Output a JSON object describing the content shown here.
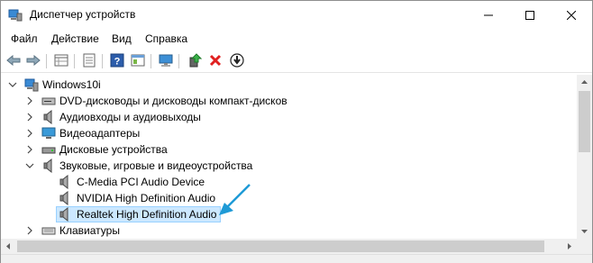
{
  "window": {
    "title": "Диспетчер устройств"
  },
  "menu": {
    "items": [
      "Файл",
      "Действие",
      "Вид",
      "Справка"
    ]
  },
  "toolbar": {
    "buttons": [
      "back-icon",
      "forward-icon",
      "properties-grid-icon",
      "device-list-icon",
      "help-icon",
      "view-icon",
      "monitor-icon",
      "update-driver-icon",
      "uninstall-icon",
      "disable-icon"
    ]
  },
  "tree": {
    "root": "Windows10i",
    "items": [
      {
        "label": "DVD-дисководы и дисководы компакт-дисков",
        "icon": "dvd-icon",
        "expanded": false
      },
      {
        "label": "Аудиовходы и аудиовыходы",
        "icon": "speaker-icon",
        "expanded": false
      },
      {
        "label": "Видеоадаптеры",
        "icon": "display-adapter-icon",
        "expanded": false
      },
      {
        "label": "Дисковые устройства",
        "icon": "disk-drive-icon",
        "expanded": false
      },
      {
        "label": "Звуковые, игровые и видеоустройства",
        "icon": "speaker-icon",
        "expanded": true,
        "children": [
          {
            "label": "C-Media PCI Audio Device",
            "icon": "speaker-icon"
          },
          {
            "label": "NVIDIA High Definition Audio",
            "icon": "speaker-icon"
          },
          {
            "label": "Realtek High Definition Audio",
            "icon": "speaker-icon",
            "selected": true
          }
        ]
      },
      {
        "label": "Клавиатуры",
        "icon": "keyboard-icon",
        "expanded": false
      }
    ]
  },
  "colors": {
    "selection": "#cce8ff",
    "annotation_arrow": "#1e9ad6"
  }
}
